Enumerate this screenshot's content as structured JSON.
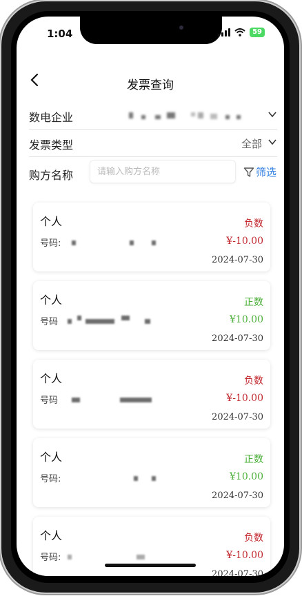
{
  "status": {
    "time": "1:04",
    "battery": "59"
  },
  "header": {
    "title": "发票查询"
  },
  "filters": {
    "company_label": "数电企业",
    "type_label": "发票类型",
    "type_value": "全部",
    "buyer_label": "购方名称",
    "buyer_placeholder": "请输入购方名称",
    "filter_label": "筛选"
  },
  "invoices": [
    {
      "name": "个人",
      "code_label": "号码:",
      "status": "负数",
      "amount": "¥-10.00",
      "date": "2024-07-30"
    },
    {
      "name": "个人",
      "code_label": "号码",
      "status": "正数",
      "amount": "¥10.00",
      "date": "2024-07-30"
    },
    {
      "name": "个人",
      "code_label": "号码",
      "status": "负数",
      "amount": "¥-10.00",
      "date": "2024-07-30"
    },
    {
      "name": "个人",
      "code_label": "号码:",
      "status": "正数",
      "amount": "¥10.00",
      "date": "2024-07-30"
    },
    {
      "name": "个人",
      "code_label": "号码:",
      "status": "负数",
      "amount": "¥-10.00",
      "date": "2024-07-30"
    }
  ],
  "colors": {
    "negative": "#c1272d",
    "positive": "#4caf3a",
    "accent": "#2f7de1"
  }
}
